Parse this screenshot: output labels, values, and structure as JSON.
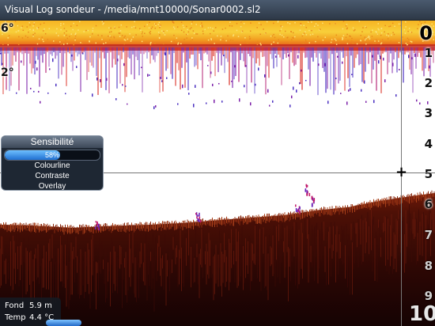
{
  "window": {
    "title": "Visual Log sondeur - /media/mnt10000/Sonar0002.sl2"
  },
  "sonar": {
    "depth_scale": [
      "0",
      "1",
      "2",
      "3",
      "4",
      "5",
      "6",
      "7",
      "8",
      "9",
      "10"
    ],
    "angle_labels": [
      "6°",
      "2°"
    ],
    "cursor_icon": "crosshair-icon",
    "colors": {
      "surface_clutter": "#f6c02a",
      "bottom": "#5a1308",
      "background": "#ffffff"
    }
  },
  "sensitivity": {
    "title": "Sensibilité",
    "level_fraction": 0.58,
    "value_label": "58%",
    "options": [
      "Colourline",
      "Contraste",
      "Overlay"
    ]
  },
  "info": {
    "depth_label": "Fond",
    "depth_value": "5.9 m",
    "temp_label": "Temp",
    "temp_value": "4.4 °C"
  }
}
